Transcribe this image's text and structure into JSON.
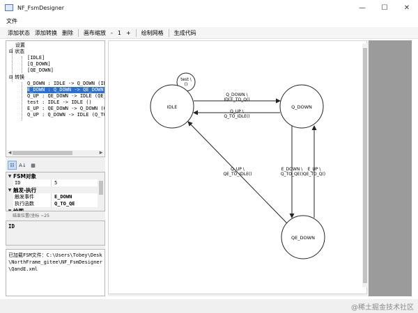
{
  "window": {
    "title": "NF_FsmDesigner",
    "controls": [
      "—",
      "☐",
      "✕"
    ]
  },
  "menu": {
    "file": "文件"
  },
  "toolbar": {
    "add_state": "添加状态",
    "add_transition": "添加转换",
    "delete": "删除",
    "canvas_zoom": "画布缩放",
    "zoom_minus": "-",
    "zoom_value": "1",
    "zoom_plus": "+",
    "draw_grid": "绘制网格",
    "generate_code": "生成代码"
  },
  "tree": {
    "root_settings": "设置",
    "states_label": "状态",
    "states": [
      "[IDLE]",
      "[Q_DOWN]",
      "[QE_DOWN]"
    ],
    "transitions_label": "转换",
    "transitions": [
      "Q_DOWN : IDLE -> Q_DOWN (IDLE_",
      "E_DOWN : Q_DOWN -> QE_DOWN (Q_",
      "Q_UP : QE_DOWN -> IDLE (QE_TO_",
      "test : IDLE -> IDLE ()",
      "E_UP : QE_DOWN -> Q_DOWN (QE_",
      "Q_UP : Q_DOWN -> IDLE (Q_TO_I"
    ],
    "selected_index": 1
  },
  "property_toolbar": {
    "categorized_icon": "categorized-icon",
    "alphabetical_icon": "sort-az-icon",
    "pages_icon": "property-pages-icon"
  },
  "property_grid": {
    "cat_fsm": "FSM对象",
    "id_name": "ID",
    "id_value": "5",
    "cat_trigger": "触发-执行",
    "trigger_event_name": "触发事件",
    "trigger_event_value": "E_DOWN",
    "exec_func_name": "执行函数",
    "exec_func_value": "Q_TO_QE",
    "cat_draw": "绘图",
    "partial_row": "结束位置(坐标 ~25"
  },
  "description": {
    "title": "ID"
  },
  "log": {
    "lines": [
      "已加载FSM文件：C:\\Users\\Tobey\\Desktop",
      "\\NorthFrame_gitee\\NF_FsmDesigner",
      "\\QandE.xml"
    ]
  },
  "diagram": {
    "states": {
      "idle": "IDLE",
      "q_down": "Q_DOWN",
      "qe_down": "QE_DOWN"
    },
    "edges": {
      "test_l1": "test \\",
      "test_l2": "()",
      "q_down_l1": "Q_DOWN \\",
      "q_down_l2": "IDLE_TO_Q()",
      "q_up_top_l1": "Q_UP \\",
      "q_up_top_l2": "Q_TO_IDLE()",
      "e_down_l1": "E_DOWN \\",
      "e_down_l2": "Q_TO_QE()",
      "e_up_l1": "E_UP \\",
      "e_up_l2": "QE_TO_Q()",
      "q_up_diag_l1": "Q_UP \\",
      "q_up_diag_l2": "QE_TO_IDLE()"
    }
  },
  "watermark": "@稀土掘金技术社区"
}
